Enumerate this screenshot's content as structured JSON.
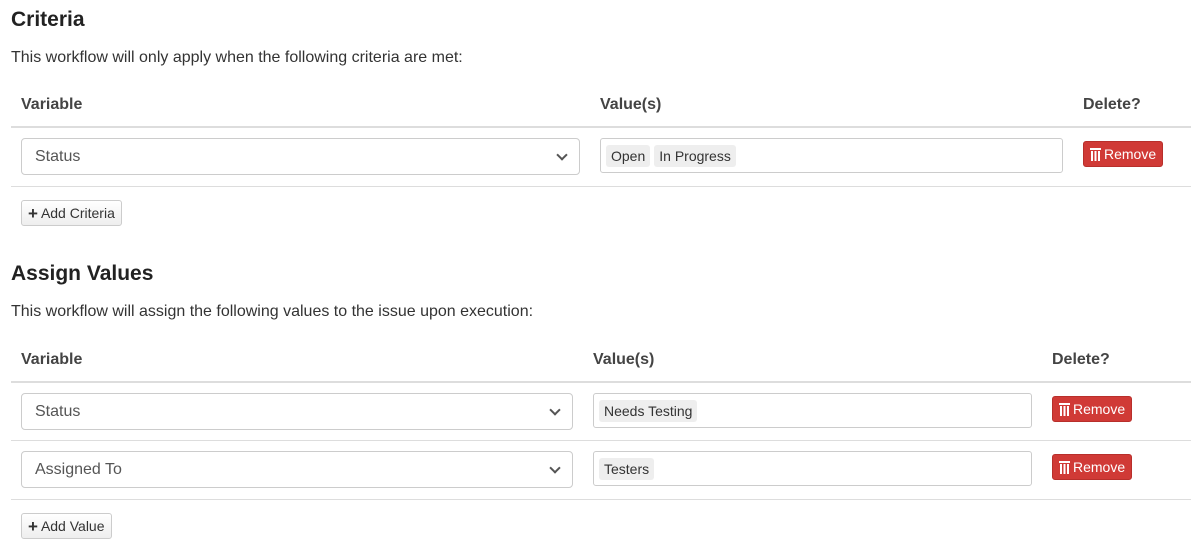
{
  "criteria": {
    "title": "Criteria",
    "description": "This workflow will only apply when the following criteria are met:",
    "headers": {
      "variable": "Variable",
      "values": "Value(s)",
      "delete": "Delete?"
    },
    "rows": [
      {
        "variable": "Status",
        "values": [
          "Open",
          "In Progress"
        ],
        "remove": "Remove"
      }
    ],
    "add_label": "Add Criteria"
  },
  "assign": {
    "title": "Assign Values",
    "description": "This workflow will assign the following values to the issue upon execution:",
    "headers": {
      "variable": "Variable",
      "values": "Value(s)",
      "delete": "Delete?"
    },
    "rows": [
      {
        "variable": "Status",
        "values": [
          "Needs Testing"
        ],
        "remove": "Remove"
      },
      {
        "variable": "Assigned To",
        "values": [
          "Testers"
        ],
        "remove": "Remove"
      }
    ],
    "add_label": "Add Value"
  },
  "colors": {
    "danger": "#d03a36",
    "border": "#dddddd"
  }
}
